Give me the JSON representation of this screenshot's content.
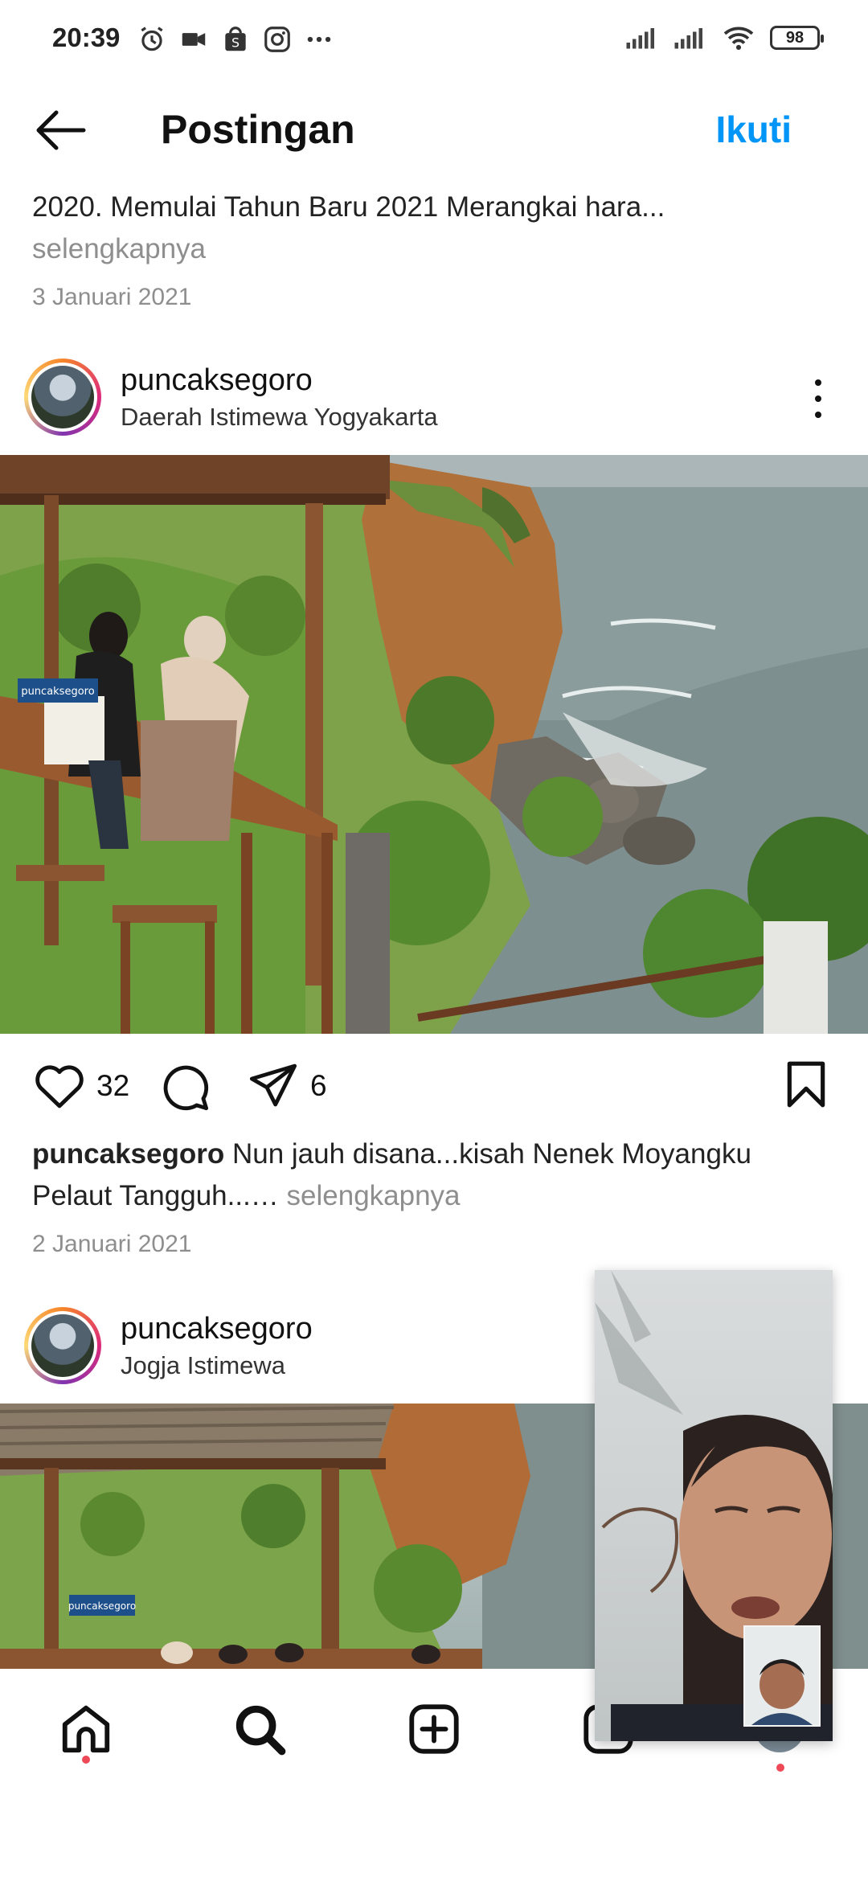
{
  "status_bar": {
    "time": "20:39",
    "battery": "98",
    "left_icons": [
      "alarm-icon",
      "video-icon",
      "shopee-icon",
      "instagram-icon",
      "more-dots-icon"
    ],
    "right_icons": [
      "signal-icon",
      "signal-icon",
      "wifi-icon",
      "battery-icon"
    ]
  },
  "header": {
    "title": "Postingan",
    "follow_label": "Ikuti"
  },
  "top_post": {
    "caption": "2020. Memulai Tahun Baru 2021 Merangkai hara...",
    "more": "selengkapnya",
    "date": "3 Januari 2021"
  },
  "post1": {
    "username": "puncaksegoro",
    "location": "Daerah Istimewa Yogyakarta",
    "sign_text": "puncaksegoro",
    "likes": "32",
    "shares": "6",
    "caption_user": "puncaksegoro",
    "caption_text": " Nun jauh disana...kisah Nenek Moyangku Pelaut Tangguh...…",
    "caption_more": " selengkapnya",
    "date": "2 Januari 2021"
  },
  "post2": {
    "username": "puncaksegoro",
    "location": "Jogja Istimewa",
    "sign_text": "puncaksegoro"
  },
  "colors": {
    "accent": "#0095f6",
    "notification": "#ed4956",
    "muted": "#8e8e8e"
  }
}
